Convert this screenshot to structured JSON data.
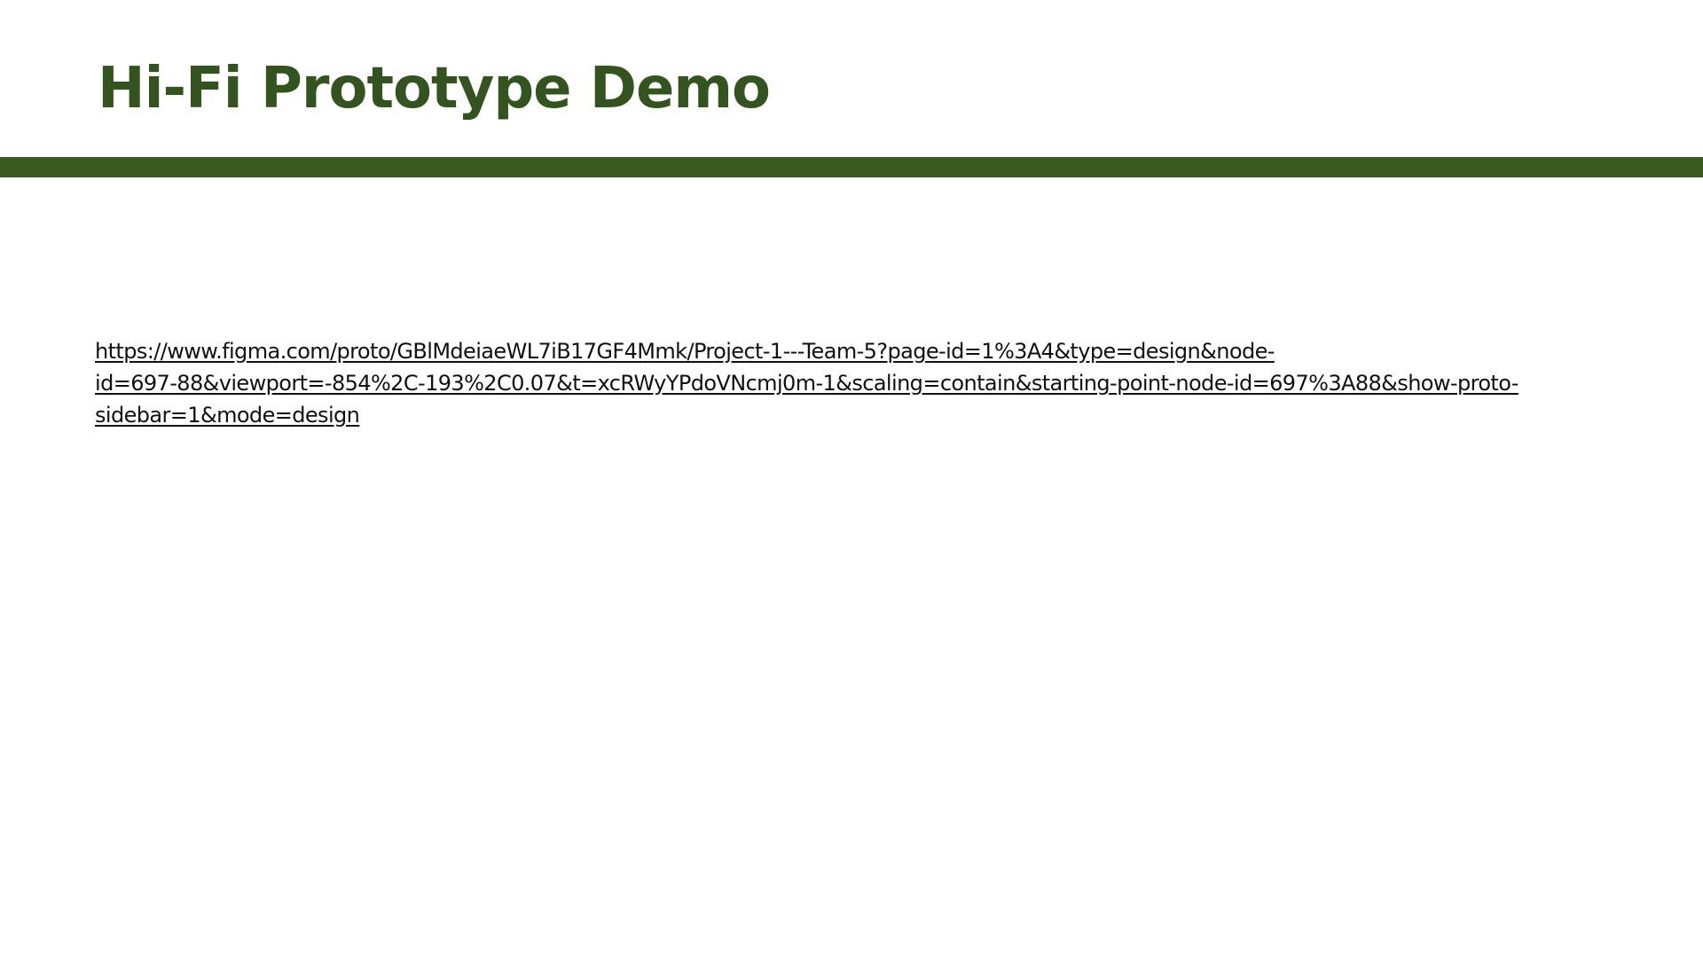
{
  "slide": {
    "title": "Hi-Fi Prototype Demo",
    "colors": {
      "title": "#33541e",
      "rule": "#3a5a1f",
      "link_text": "#111111",
      "background": "#ffffff"
    },
    "prototype_link": {
      "lines": [
        "https://www.figma.com/proto/GBlMdeiaeWL7iB17GF4Mmk/Project-1---Team-5?page-id=1%3A4&type=design&node-",
        "id=697-88&viewport=-854%2C-193%2C0.07&t=xcRWyYPdoVNcmj0m-1&scaling=contain&starting-point-node-id=697%3A88&show-proto-",
        "sidebar=1&mode=design"
      ]
    }
  }
}
